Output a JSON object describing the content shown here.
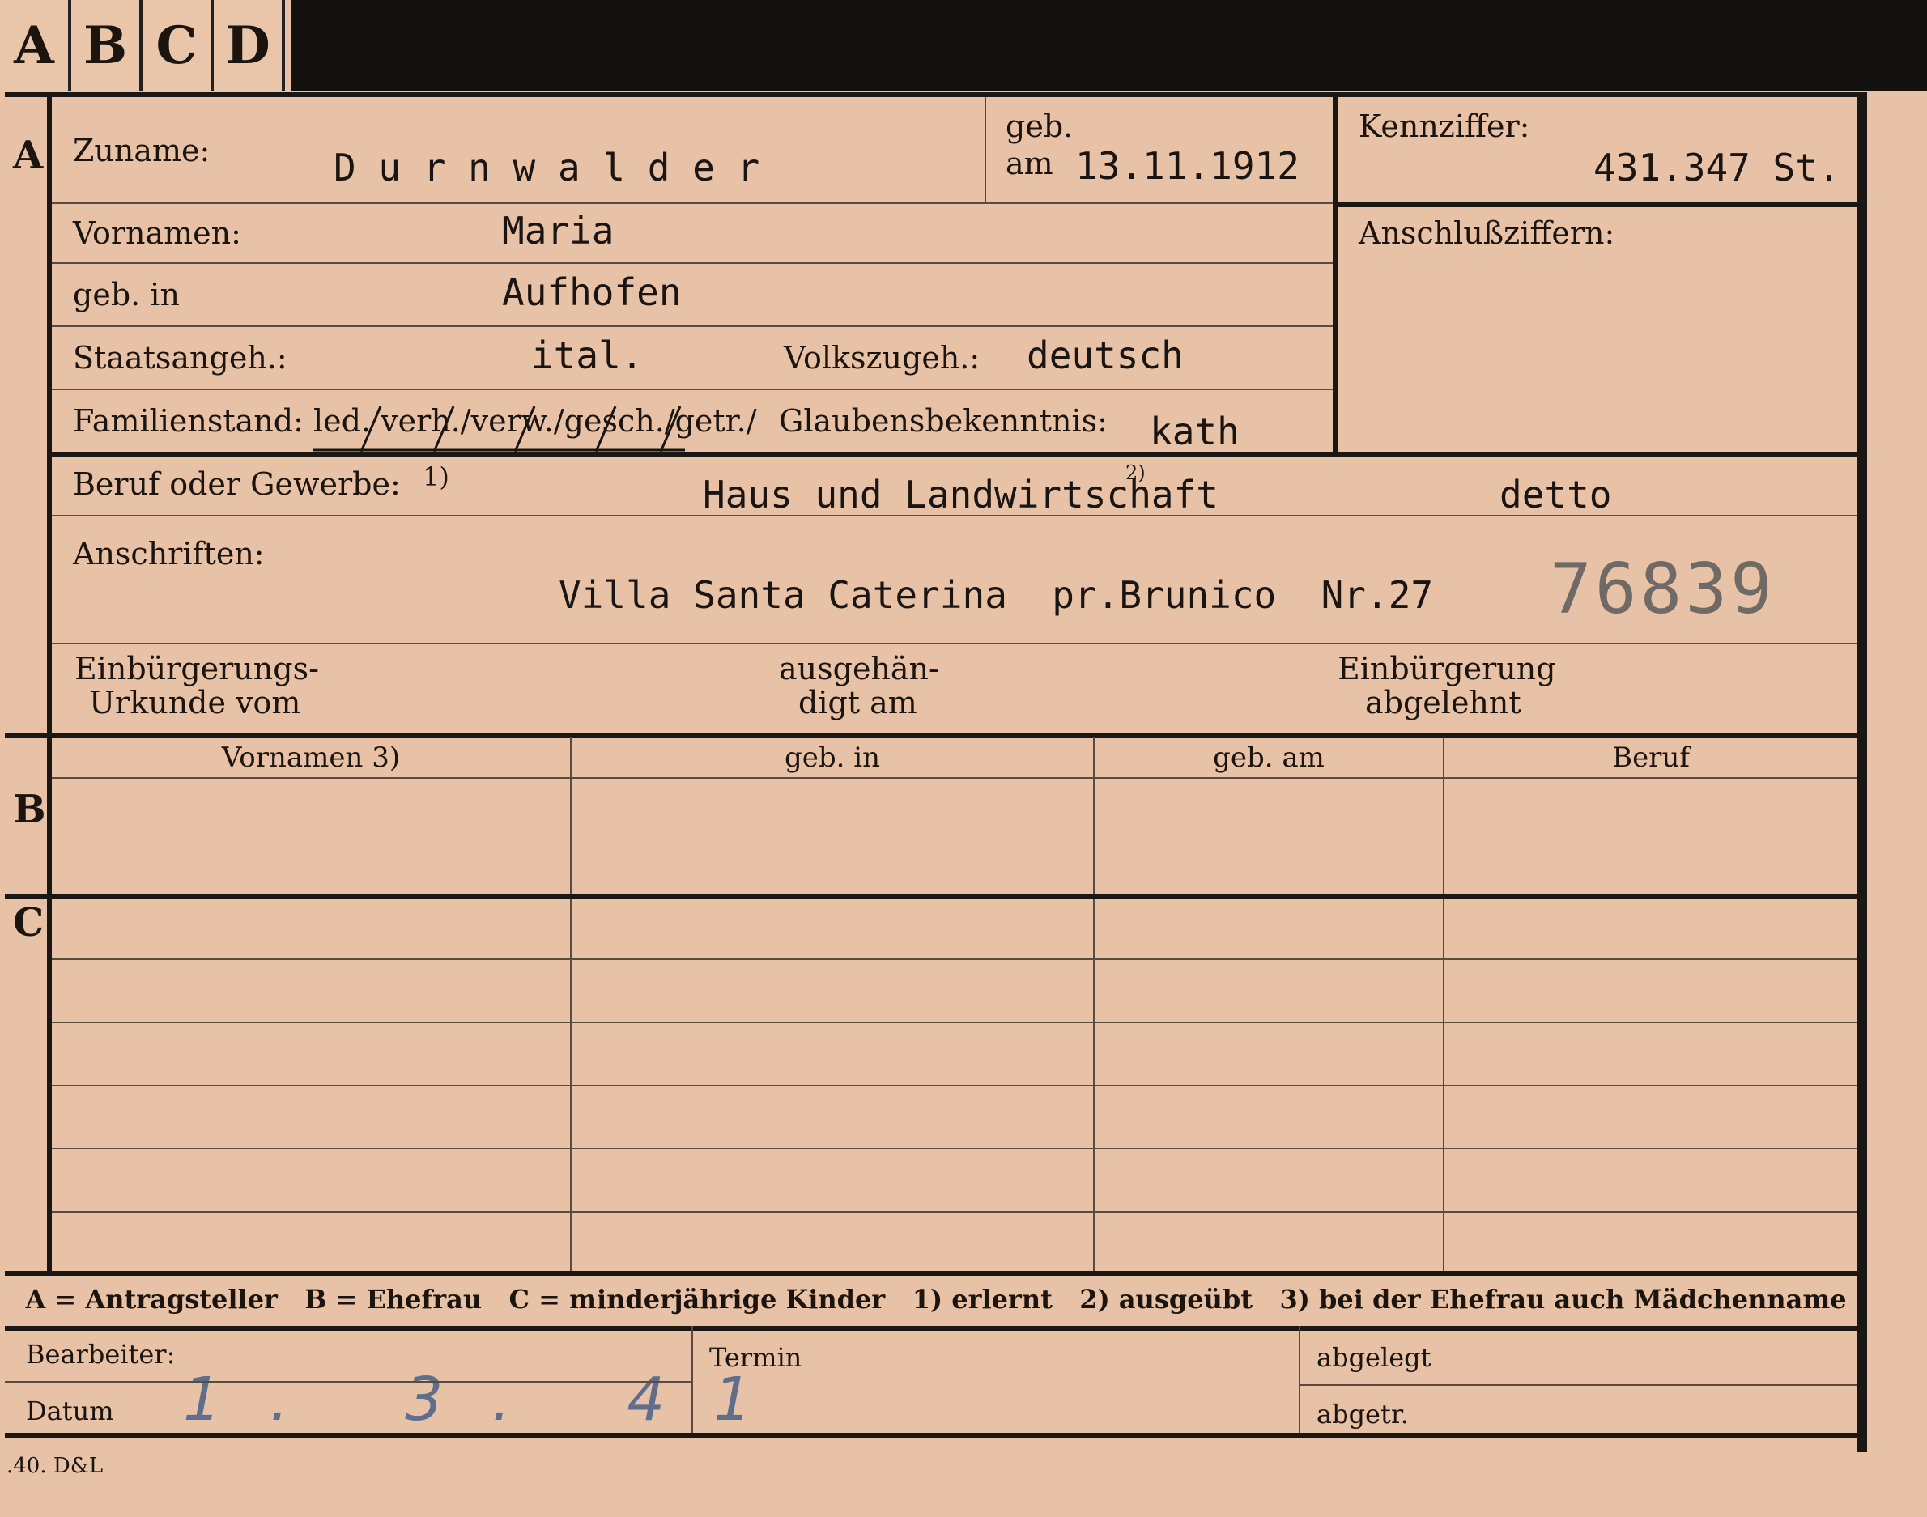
{
  "tabs": [
    "A",
    "B",
    "C",
    "D"
  ],
  "sections": {
    "a": "A",
    "b": "B",
    "c": "C"
  },
  "labels": {
    "zuname": "Zuname:",
    "geb": "geb.",
    "am": "am",
    "kennziffer": "Kennziffer:",
    "vornamen": "Vornamen:",
    "anschlussziffern": "Anschlußziffern:",
    "geb_in": "geb. in",
    "staatsangeh": "Staatsangeh.:",
    "volkszugeh": "Volkszugeh.:",
    "familienstand": "Familienstand: led. verh./verw./gesch./getr./",
    "glaubensbekenntnis": "Glaubensbekenntnis:",
    "beruf": "Beruf oder Gewerbe:",
    "beruf_note": "1)",
    "beruf_note2": "2)",
    "anschriften": "Anschriften:",
    "einbuergerung1": "Einbürgerungs-",
    "einbuergerung2": "Urkunde vom",
    "ausgehaen1": "ausgehän-",
    "ausgehaen2": "digt am",
    "abgelehnt1": "Einbürgerung",
    "abgelehnt2": "abgelehnt",
    "bearbeiter": "Bearbeiter:",
    "datum": "Datum",
    "termin": "Termin",
    "abgelegt": "abgelegt",
    "abgetr": "abgetr.",
    "footer": ".40. D&L"
  },
  "columns": [
    "Vornamen 3)",
    "geb. in",
    "geb. am",
    "Beruf"
  ],
  "legend": "A = Antragsteller   B = Ehefrau   C = minderjährige Kinder   1) erlernt   2) ausgeübt   3) bei der Ehefrau auch Mädchenname",
  "values": {
    "zuname": "D u r n w a l d e r",
    "geb_am": "13.11.1912",
    "kennziffer": "431.347 St.",
    "vornamen": "Maria",
    "geb_in": "Aufhofen",
    "staatsangeh": "ital.",
    "volkszugeh": "deutsch",
    "glaubensbekenntnis": "kath",
    "beruf": "Haus und Landwirtschaft",
    "beruf_ausgeuebt": "detto",
    "anschrift": "Villa Santa Caterina  pr.Brunico  Nr.27",
    "stamp": "76839",
    "datum_hand": "1. 3. 41"
  }
}
